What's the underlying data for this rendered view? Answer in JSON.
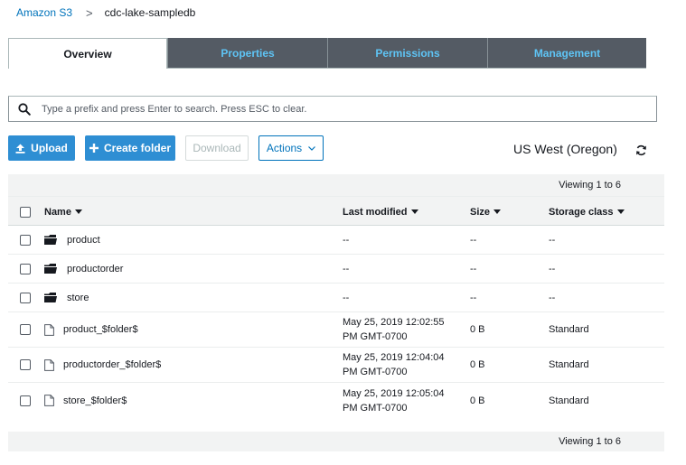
{
  "breadcrumb": {
    "root": "Amazon S3",
    "separator": ">",
    "current": "cdc-lake-sampledb"
  },
  "tabs": [
    {
      "label": "Overview",
      "active": true
    },
    {
      "label": "Properties",
      "active": false
    },
    {
      "label": "Permissions",
      "active": false
    },
    {
      "label": "Management",
      "active": false
    }
  ],
  "search": {
    "placeholder": "Type a prefix and press Enter to search. Press ESC to clear.",
    "value": ""
  },
  "toolbar": {
    "upload": "Upload",
    "create_folder": "Create folder",
    "download": "Download",
    "actions": "Actions",
    "region": "US West (Oregon)"
  },
  "table": {
    "viewing": "Viewing 1 to 6",
    "headers": {
      "name": "Name",
      "modified": "Last modified",
      "size": "Size",
      "class": "Storage class"
    },
    "rows": [
      {
        "type": "folder",
        "name": "product",
        "modified_1": "--",
        "modified_2": "",
        "size": "--",
        "class": "--"
      },
      {
        "type": "folder",
        "name": "productorder",
        "modified_1": "--",
        "modified_2": "",
        "size": "--",
        "class": "--"
      },
      {
        "type": "folder",
        "name": "store",
        "modified_1": "--",
        "modified_2": "",
        "size": "--",
        "class": "--"
      },
      {
        "type": "file",
        "name": "product_$folder$",
        "modified_1": "May 25, 2019 12:02:55",
        "modified_2": "PM GMT-0700",
        "size": "0 B",
        "class": "Standard"
      },
      {
        "type": "file",
        "name": "productorder_$folder$",
        "modified_1": "May 25, 2019 12:04:04",
        "modified_2": "PM GMT-0700",
        "size": "0 B",
        "class": "Standard"
      },
      {
        "type": "file",
        "name": "store_$folder$",
        "modified_1": "May 25, 2019 12:05:04",
        "modified_2": "PM GMT-0700",
        "size": "0 B",
        "class": "Standard"
      }
    ],
    "viewing_bottom": "Viewing 1 to 6"
  },
  "colors": {
    "accent": "#2e8ed3",
    "tab_bg": "#545b64",
    "tab_text": "#5ec4f5",
    "link": "#0073bb"
  },
  "icons": {
    "search": "search-icon",
    "upload": "upload-icon",
    "add": "plus-icon",
    "refresh": "refresh-icon",
    "folder": "folder-icon",
    "file": "file-icon"
  }
}
